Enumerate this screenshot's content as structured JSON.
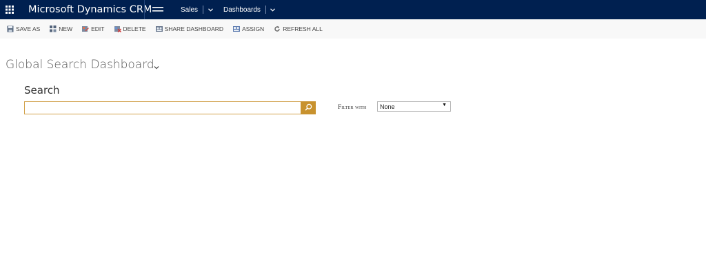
{
  "navbar": {
    "app_title": "Microsoft Dynamics CRM",
    "area": "Sales",
    "subarea": "Dashboards",
    "background": "#002050"
  },
  "commands": [
    {
      "label": "SAVE AS",
      "icon": "save-as-icon"
    },
    {
      "label": "NEW",
      "icon": "new-icon"
    },
    {
      "label": "EDIT",
      "icon": "edit-icon"
    },
    {
      "label": "DELETE",
      "icon": "delete-icon"
    },
    {
      "label": "SHARE DASHBOARD",
      "icon": "share-icon"
    },
    {
      "label": "ASSIGN",
      "icon": "assign-icon"
    },
    {
      "label": "REFRESH ALL",
      "icon": "refresh-icon"
    }
  ],
  "dashboard": {
    "title": "Global Search Dashboard"
  },
  "search": {
    "label": "Search",
    "value": "",
    "placeholder": "",
    "accent": "#c8922e"
  },
  "filter": {
    "label": "Filter with",
    "selected": "None"
  }
}
